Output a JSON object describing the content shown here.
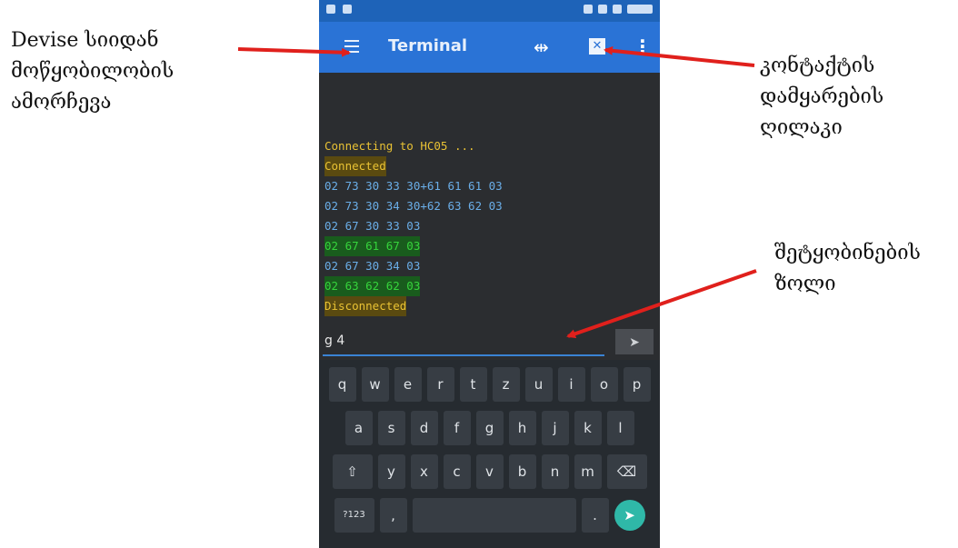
{
  "annotations": {
    "left": [
      "Devise სიიდან",
      "მოწყობილობის",
      "ამორჩევა"
    ],
    "right_top": [
      "კონტაქტის",
      "დამყარების",
      "ღილაკი"
    ],
    "right_bottom": [
      "შეტყობინების",
      "ზოლი"
    ]
  },
  "arrow_color": "#e0201c",
  "app": {
    "title": "Terminal",
    "icons": {
      "menu": "hamburger-icon",
      "connect": "connect-icon",
      "clear": "delete-icon",
      "overflow": "overflow-menu-icon"
    },
    "accent": "#2a73d6"
  },
  "terminal_lines": [
    {
      "text": "Connecting to HC05 ...",
      "kind": "status"
    },
    {
      "text": "Connected",
      "kind": "status-hl"
    },
    {
      "text": "02 73 30 33 30+61 61 61 03",
      "kind": "recv"
    },
    {
      "text": "02 73 30 34 30+62 63 62 03",
      "kind": "recv"
    },
    {
      "text": "02 67 30 33 03",
      "kind": "recv"
    },
    {
      "text": "02 67 61 67 03",
      "kind": "sent"
    },
    {
      "text": "02 67 30 34 03",
      "kind": "recv"
    },
    {
      "text": "02 63 62 62 03",
      "kind": "sent"
    },
    {
      "text": "Disconnected",
      "kind": "status-hl"
    }
  ],
  "input": {
    "value": "g 4",
    "send_label": "➤"
  },
  "keyboard": {
    "row1": [
      "q",
      "w",
      "e",
      "r",
      "t",
      "z",
      "u",
      "i",
      "o",
      "p"
    ],
    "row2": [
      "a",
      "s",
      "d",
      "f",
      "g",
      "h",
      "j",
      "k",
      "l"
    ],
    "row3": [
      "⇧",
      "y",
      "x",
      "c",
      "v",
      "b",
      "n",
      "m",
      "⌫"
    ],
    "row4": [
      "?123",
      ",",
      "",
      ".",
      "➤"
    ]
  }
}
